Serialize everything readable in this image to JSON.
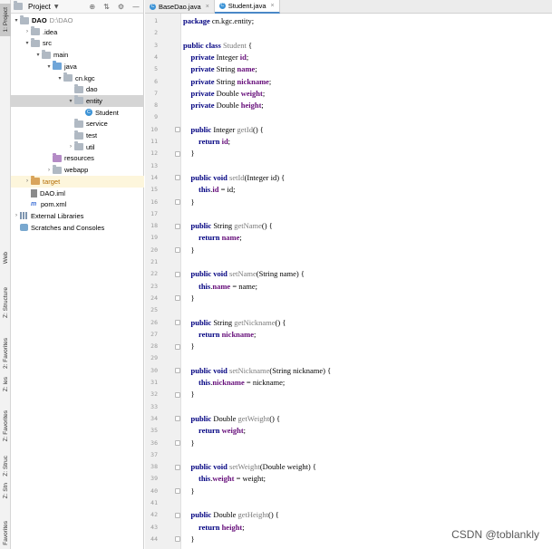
{
  "toolstrip": {
    "tabs": [
      "1: Project",
      "Web",
      "Z: Structure",
      "2: Favorites",
      "Z: Ies",
      "Z: Favorites",
      "Z: Struc",
      "Z: Stn",
      "Favorites"
    ]
  },
  "project_panel": {
    "title": "Project",
    "tree": [
      {
        "label": "DAO",
        "extra": "D:\\DAO",
        "depth": 0,
        "arrow": "down",
        "icon": "folder-icon",
        "bold": true
      },
      {
        "label": ".idea",
        "depth": 1,
        "arrow": "right",
        "icon": "folder-icon"
      },
      {
        "label": "src",
        "depth": 1,
        "arrow": "down",
        "icon": "folder-icon"
      },
      {
        "label": "main",
        "depth": 2,
        "arrow": "down",
        "icon": "folder-icon"
      },
      {
        "label": "java",
        "depth": 3,
        "arrow": "down",
        "icon": "folder-blue-icon"
      },
      {
        "label": "cn.kgc",
        "depth": 4,
        "arrow": "down",
        "icon": "package-icon"
      },
      {
        "label": "dao",
        "depth": 5,
        "arrow": "",
        "icon": "package-icon"
      },
      {
        "label": "entity",
        "depth": 5,
        "arrow": "down",
        "icon": "package-icon",
        "selected": true
      },
      {
        "label": "Student",
        "depth": 6,
        "arrow": "",
        "icon": "class-icon"
      },
      {
        "label": "service",
        "depth": 5,
        "arrow": "",
        "icon": "package-icon"
      },
      {
        "label": "test",
        "depth": 5,
        "arrow": "",
        "icon": "package-icon"
      },
      {
        "label": "util",
        "depth": 5,
        "arrow": "right",
        "icon": "package-icon"
      },
      {
        "label": "resources",
        "depth": 3,
        "arrow": "",
        "icon": "resources-folder-icon"
      },
      {
        "label": "webapp",
        "depth": 3,
        "arrow": "right",
        "icon": "folder-icon"
      },
      {
        "label": "target",
        "depth": 1,
        "arrow": "right",
        "icon": "folder-orange-icon",
        "highlight": true,
        "orange": true
      },
      {
        "label": "DAO.iml",
        "depth": 1,
        "arrow": "",
        "icon": "iml-file-icon"
      },
      {
        "label": "pom.xml",
        "depth": 1,
        "arrow": "",
        "icon": "maven-file-icon"
      },
      {
        "label": "External Libraries",
        "depth": 0,
        "arrow": "right",
        "icon": "library-icon"
      },
      {
        "label": "Scratches and Consoles",
        "depth": 0,
        "arrow": "",
        "icon": "scratches-icon"
      }
    ]
  },
  "editor": {
    "tabs": [
      {
        "label": "BaseDao.java",
        "active": false
      },
      {
        "label": "Student.java",
        "active": true
      }
    ],
    "lines": [
      [
        [
          "kw",
          "package"
        ],
        [
          "t",
          " cn.kgc.entity;"
        ]
      ],
      [],
      [
        [
          "kw",
          "public class"
        ],
        [
          "t",
          " "
        ],
        [
          "cls",
          "Student"
        ],
        [
          "t",
          " {"
        ]
      ],
      [
        [
          "t",
          "    "
        ],
        [
          "kw",
          "private"
        ],
        [
          "t",
          " Integer "
        ],
        [
          "field",
          "id"
        ],
        [
          "t",
          ";"
        ]
      ],
      [
        [
          "t",
          "    "
        ],
        [
          "kw",
          "private"
        ],
        [
          "t",
          " String "
        ],
        [
          "field",
          "name"
        ],
        [
          "t",
          ";"
        ]
      ],
      [
        [
          "t",
          "    "
        ],
        [
          "kw",
          "private"
        ],
        [
          "t",
          " String "
        ],
        [
          "field",
          "nickname"
        ],
        [
          "t",
          ";"
        ]
      ],
      [
        [
          "t",
          "    "
        ],
        [
          "kw",
          "private"
        ],
        [
          "t",
          " Double "
        ],
        [
          "field",
          "weight"
        ],
        [
          "t",
          ";"
        ]
      ],
      [
        [
          "t",
          "    "
        ],
        [
          "kw",
          "private"
        ],
        [
          "t",
          " Double "
        ],
        [
          "field",
          "height"
        ],
        [
          "t",
          ";"
        ]
      ],
      [],
      [
        [
          "t",
          "    "
        ],
        [
          "kw",
          "public"
        ],
        [
          "t",
          " Integer "
        ],
        [
          "fn",
          "getId"
        ],
        [
          "t",
          "() {"
        ]
      ],
      [
        [
          "t",
          "        "
        ],
        [
          "kw",
          "return"
        ],
        [
          "t",
          " "
        ],
        [
          "field",
          "id"
        ],
        [
          "t",
          ";"
        ]
      ],
      [
        [
          "t",
          "    }"
        ]
      ],
      [],
      [
        [
          "t",
          "    "
        ],
        [
          "kw",
          "public void"
        ],
        [
          "t",
          " "
        ],
        [
          "fn",
          "setId"
        ],
        [
          "t",
          "(Integer id) {"
        ]
      ],
      [
        [
          "t",
          "        "
        ],
        [
          "kw",
          "this"
        ],
        [
          "t",
          "."
        ],
        [
          "field",
          "id"
        ],
        [
          "t",
          " = id;"
        ]
      ],
      [
        [
          "t",
          "    }"
        ]
      ],
      [],
      [
        [
          "t",
          "    "
        ],
        [
          "kw",
          "public"
        ],
        [
          "t",
          " String "
        ],
        [
          "fn",
          "getName"
        ],
        [
          "t",
          "() {"
        ]
      ],
      [
        [
          "t",
          "        "
        ],
        [
          "kw",
          "return"
        ],
        [
          "t",
          " "
        ],
        [
          "field",
          "name"
        ],
        [
          "t",
          ";"
        ]
      ],
      [
        [
          "t",
          "    }"
        ]
      ],
      [],
      [
        [
          "t",
          "    "
        ],
        [
          "kw",
          "public void"
        ],
        [
          "t",
          " "
        ],
        [
          "fn",
          "setName"
        ],
        [
          "t",
          "(String name) {"
        ]
      ],
      [
        [
          "t",
          "        "
        ],
        [
          "kw",
          "this"
        ],
        [
          "t",
          "."
        ],
        [
          "field",
          "name"
        ],
        [
          "t",
          " = name;"
        ]
      ],
      [
        [
          "t",
          "    }"
        ]
      ],
      [],
      [
        [
          "t",
          "    "
        ],
        [
          "kw",
          "public"
        ],
        [
          "t",
          " String "
        ],
        [
          "fn",
          "getNickname"
        ],
        [
          "t",
          "() {"
        ]
      ],
      [
        [
          "t",
          "        "
        ],
        [
          "kw",
          "return"
        ],
        [
          "t",
          " "
        ],
        [
          "field",
          "nickname"
        ],
        [
          "t",
          ";"
        ]
      ],
      [
        [
          "t",
          "    }"
        ]
      ],
      [],
      [
        [
          "t",
          "    "
        ],
        [
          "kw",
          "public void"
        ],
        [
          "t",
          " "
        ],
        [
          "fn",
          "setNickname"
        ],
        [
          "t",
          "(String nickname) {"
        ]
      ],
      [
        [
          "t",
          "        "
        ],
        [
          "kw",
          "this"
        ],
        [
          "t",
          "."
        ],
        [
          "field",
          "nickname"
        ],
        [
          "t",
          " = nickname;"
        ]
      ],
      [
        [
          "t",
          "    }"
        ]
      ],
      [],
      [
        [
          "t",
          "    "
        ],
        [
          "kw",
          "public"
        ],
        [
          "t",
          " Double "
        ],
        [
          "fn",
          "getWeight"
        ],
        [
          "t",
          "() {"
        ]
      ],
      [
        [
          "t",
          "        "
        ],
        [
          "kw",
          "return"
        ],
        [
          "t",
          " "
        ],
        [
          "field",
          "weight"
        ],
        [
          "t",
          ";"
        ]
      ],
      [
        [
          "t",
          "    }"
        ]
      ],
      [],
      [
        [
          "t",
          "    "
        ],
        [
          "kw",
          "public void"
        ],
        [
          "t",
          " "
        ],
        [
          "fn",
          "setWeight"
        ],
        [
          "t",
          "(Double weight) {"
        ]
      ],
      [
        [
          "t",
          "        "
        ],
        [
          "kw",
          "this"
        ],
        [
          "t",
          "."
        ],
        [
          "field",
          "weight"
        ],
        [
          "t",
          " = weight;"
        ]
      ],
      [
        [
          "t",
          "    }"
        ]
      ],
      [],
      [
        [
          "t",
          "    "
        ],
        [
          "kw",
          "public"
        ],
        [
          "t",
          " Double "
        ],
        [
          "fn",
          "getHeight"
        ],
        [
          "t",
          "() {"
        ]
      ],
      [
        [
          "t",
          "        "
        ],
        [
          "kw",
          "return"
        ],
        [
          "t",
          " "
        ],
        [
          "field",
          "height"
        ],
        [
          "t",
          ";"
        ]
      ],
      [
        [
          "t",
          "    }"
        ]
      ]
    ],
    "fold_markers": [
      10,
      12,
      14,
      16,
      18,
      20,
      22,
      24,
      26,
      28,
      30,
      32,
      34,
      36,
      38,
      40,
      42,
      44
    ]
  },
  "watermark": "CSDN @toblankly"
}
